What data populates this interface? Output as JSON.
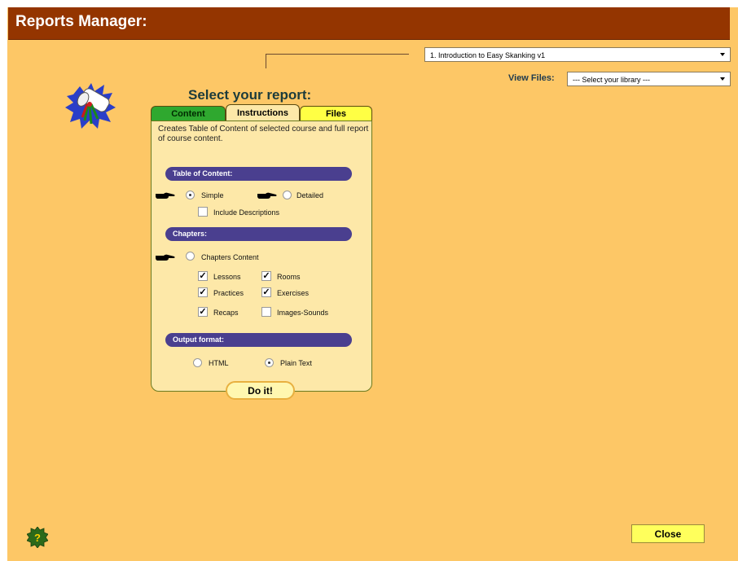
{
  "app": {
    "title": "Reports Manager:"
  },
  "course_select": {
    "value": "1. Introduction to Easy Skanking v1"
  },
  "library": {
    "label": "View Files:",
    "value": "--- Select  your  library  ---"
  },
  "heading": "Select your report:",
  "tabs": [
    {
      "label": "Content",
      "active": false
    },
    {
      "label": "Instructions",
      "active": true
    },
    {
      "label": "Files",
      "active": false
    }
  ],
  "description": "Creates Table of Content of selected course and full report of course content.",
  "toc": {
    "section_label": "Table of Content:",
    "simple_label": "Simple",
    "detailed_label": "Detailed",
    "include_descriptions_label": "Include Descriptions",
    "selected": "Simple",
    "include_descriptions": false
  },
  "chapters": {
    "section_label": "Chapters:",
    "chapters_content_label": "Chapters Content",
    "chapters_content_selected": false,
    "options": [
      {
        "label": "Lessons",
        "checked": true
      },
      {
        "label": "Rooms",
        "checked": true
      },
      {
        "label": "Practices",
        "checked": true
      },
      {
        "label": "Exercises",
        "checked": true
      },
      {
        "label": "Recaps",
        "checked": true
      },
      {
        "label": "Images-Sounds",
        "checked": false
      }
    ]
  },
  "output": {
    "section_label": "Output format:",
    "html_label": "HTML",
    "plain_text_label": "Plain Text",
    "selected": "Plain Text"
  },
  "buttons": {
    "do_it": "Do it!",
    "close": "Close"
  },
  "icons": {
    "help": "help-question-icon",
    "logo": "diploma-scroll-icon",
    "pointer": "pointing-hand-icon"
  },
  "colors": {
    "titlebar": "#943500",
    "background": "#fdc766",
    "section_bar": "#4a3f8f",
    "tab_content": "#2fa82f",
    "tab_files": "#ffff44"
  }
}
